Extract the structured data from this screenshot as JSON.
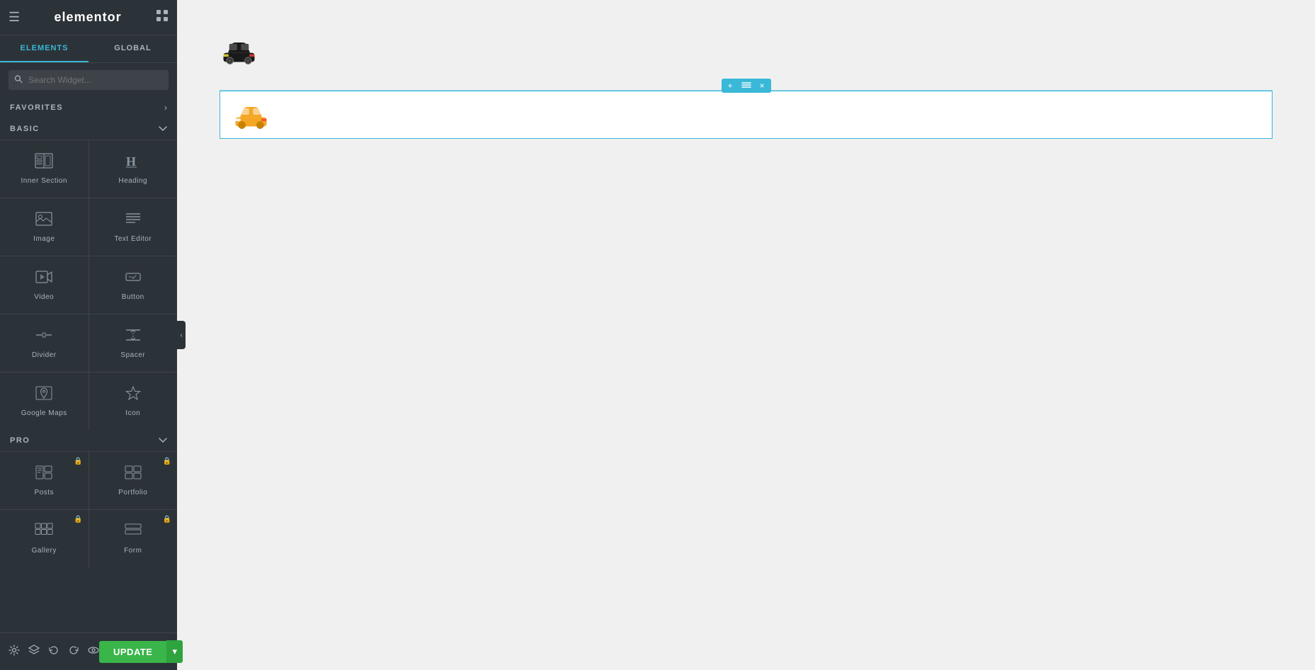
{
  "header": {
    "hamburger": "☰",
    "logo": "elementor",
    "grid": "⊞"
  },
  "tabs": [
    {
      "label": "ELEMENTS",
      "active": true
    },
    {
      "label": "GLOBAL",
      "active": false
    }
  ],
  "search": {
    "placeholder": "Search Widget..."
  },
  "favorites": {
    "label": "FAVORITES",
    "arrow": "›"
  },
  "basic": {
    "label": "BASIC",
    "arrow": "⌄",
    "elements": [
      {
        "id": "inner-section",
        "label": "Inner Section",
        "icon": "inner-section"
      },
      {
        "id": "heading",
        "label": "Heading",
        "icon": "heading"
      },
      {
        "id": "image",
        "label": "Image",
        "icon": "image"
      },
      {
        "id": "text-editor",
        "label": "Text Editor",
        "icon": "text-editor"
      },
      {
        "id": "video",
        "label": "Video",
        "icon": "video"
      },
      {
        "id": "button",
        "label": "Button",
        "icon": "button"
      },
      {
        "id": "divider",
        "label": "Divider",
        "icon": "divider"
      },
      {
        "id": "spacer",
        "label": "Spacer",
        "icon": "spacer"
      },
      {
        "id": "google-maps",
        "label": "Google Maps",
        "icon": "google-maps"
      },
      {
        "id": "icon",
        "label": "Icon",
        "icon": "icon-widget"
      }
    ]
  },
  "pro": {
    "label": "PRO",
    "arrow": "⌄",
    "elements": [
      {
        "id": "posts",
        "label": "Posts",
        "icon": "posts",
        "locked": true
      },
      {
        "id": "portfolio",
        "label": "Portfolio",
        "icon": "portfolio",
        "locked": true
      },
      {
        "id": "gallery",
        "label": "Gallery",
        "icon": "gallery",
        "locked": true
      },
      {
        "id": "form",
        "label": "Form",
        "icon": "form",
        "locked": true
      }
    ]
  },
  "footer": {
    "update_label": "UPDATE",
    "arrow": "▾"
  },
  "canvas": {
    "toolbar": {
      "add": "+",
      "move": "⠿",
      "close": "×"
    }
  }
}
